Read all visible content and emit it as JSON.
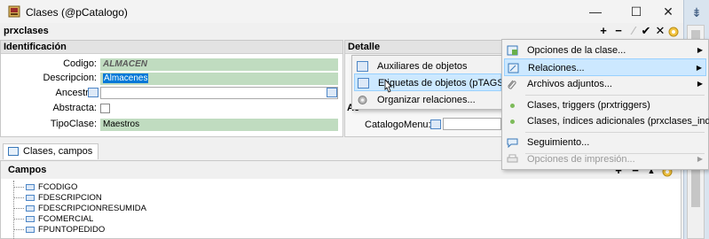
{
  "window": {
    "title": "Clases (@pCatalogo)"
  },
  "toolbar": {
    "name": "prxclases",
    "add": "+",
    "remove": "−",
    "confirm": "✔",
    "close": "✕"
  },
  "identificacion": {
    "header": "Identificación",
    "codigo_label": "Codigo:",
    "codigo_value": "ALMACEN",
    "descripcion_label": "Descripcion:",
    "descripcion_value": "Almacenes",
    "ancestro_label": "Ancestro:",
    "abstracta_label": "Abstracta:",
    "tipoclase_label": "TipoClase:",
    "tipoclase_value": "Maestros"
  },
  "detalle": {
    "header": "Detalle",
    "partial_label": "Ac",
    "catalogomenu_label": "CatalogoMenu:"
  },
  "submenu": {
    "items": [
      {
        "label": "Auxiliares de objetos",
        "icon": "list-icon"
      },
      {
        "label": "Etiquetas de objetos (pTAGS)",
        "icon": "tag-icon",
        "highlighted": true
      },
      {
        "label": "Organizar relaciones...",
        "icon": "gear-icon"
      }
    ]
  },
  "menu": {
    "items": [
      {
        "label": "Opciones de la clase...",
        "icon": "options-icon",
        "has_submenu": true
      },
      {
        "label": "Relaciones...",
        "icon": "relations-icon",
        "has_submenu": true,
        "highlighted": true
      },
      {
        "label": "Archivos adjuntos...",
        "icon": "paperclip-icon",
        "has_submenu": true
      },
      {
        "label": "Clases, triggers (prxtriggers)",
        "icon": "dot-icon"
      },
      {
        "label": "Clases, índices adicionales (prxclases_indice)",
        "icon": "dot-icon"
      },
      {
        "label": "Seguimiento...",
        "icon": "chat-icon"
      },
      {
        "label": "Opciones de impresión...",
        "icon": "print-icon",
        "has_submenu": true,
        "disabled": true
      }
    ]
  },
  "tab": {
    "label": "Clases, campos"
  },
  "campos": {
    "header": "Campos",
    "add": "+",
    "remove": "−",
    "up": "▲",
    "fields": [
      "FCODIGO",
      "FDESCRIPCION",
      "FDESCRIPCIONRESUMIDA",
      "FCOMERCIAL",
      "FPUNTOPEDIDO"
    ]
  },
  "colors": {
    "highlight": "#cce8ff",
    "field_bg": "#c0dcc0",
    "selection": "#0078d7"
  }
}
